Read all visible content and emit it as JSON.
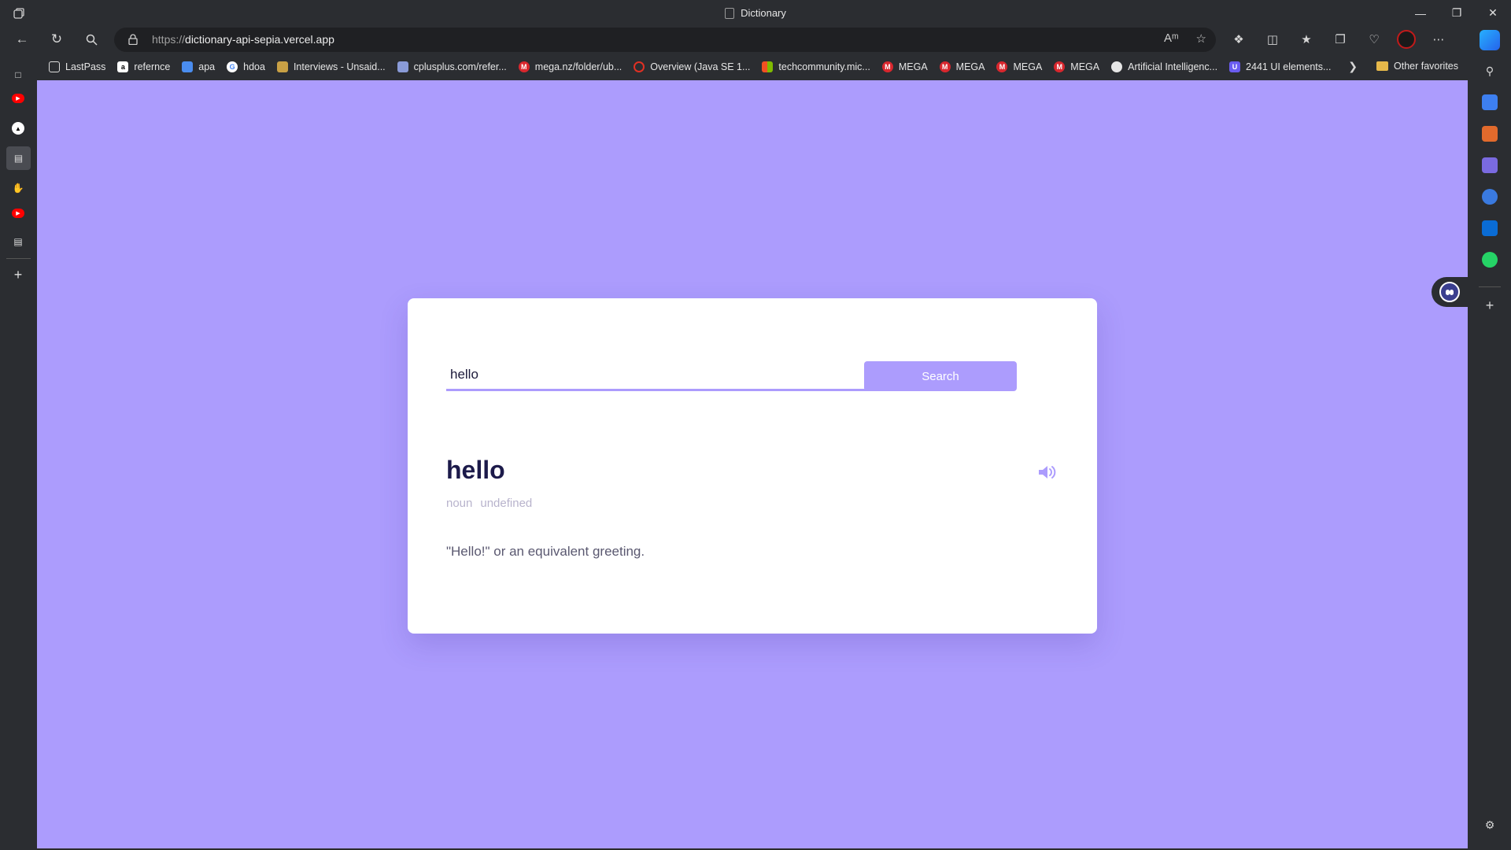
{
  "window": {
    "title": "Dictionary",
    "controls": [
      "minimize",
      "restore",
      "close"
    ]
  },
  "address_bar": {
    "protocol": "https://",
    "host": "dictionary-api-sepia.vercel.app"
  },
  "favorites": [
    {
      "label": "LastPass",
      "icon": "page-icon",
      "color": "#dddddd"
    },
    {
      "label": "refernce",
      "icon": "amazon-icon",
      "color": "#ffffff"
    },
    {
      "label": "apa",
      "icon": "apa-icon",
      "color": "#4a8df0"
    },
    {
      "label": "hdoa",
      "icon": "google-icon",
      "color": "#ffffff"
    },
    {
      "label": "Interviews - Unsaid...",
      "icon": "interviews-icon",
      "color": "#c8a045"
    },
    {
      "label": "cplusplus.com/refer...",
      "icon": "cplusplus-icon",
      "color": "#8a9bd8"
    },
    {
      "label": "mega.nz/folder/ub...",
      "icon": "mega-icon",
      "color": "#d9272e"
    },
    {
      "label": "Overview (Java SE 1...",
      "icon": "oracle-icon",
      "color": "#e03024"
    },
    {
      "label": "techcommunity.mic...",
      "icon": "microsoft-icon",
      "color": "#f25022"
    },
    {
      "label": "MEGA",
      "icon": "mega-icon",
      "color": "#d9272e"
    },
    {
      "label": "MEGA",
      "icon": "mega-icon",
      "color": "#d9272e"
    },
    {
      "label": "MEGA",
      "icon": "mega-icon",
      "color": "#d9272e"
    },
    {
      "label": "MEGA",
      "icon": "mega-icon",
      "color": "#d9272e"
    },
    {
      "label": "Artificial Intelligenc...",
      "icon": "ai-icon",
      "color": "#e6e6e6"
    },
    {
      "label": "2441 UI elements...",
      "icon": "ui-icon",
      "color": "#6a5cf0"
    }
  ],
  "other_favorites_label": "Other favorites",
  "colors": {
    "background": "#ac9cfd",
    "accent": "#ac9cfd",
    "heading": "#1c1a4a"
  },
  "app": {
    "search": {
      "value": "hello",
      "button_label": "Search"
    },
    "result": {
      "word": "hello",
      "part_of_speech": "noun",
      "phonetic": "undefined",
      "definition": "\"Hello!\" or an equivalent greeting."
    }
  }
}
